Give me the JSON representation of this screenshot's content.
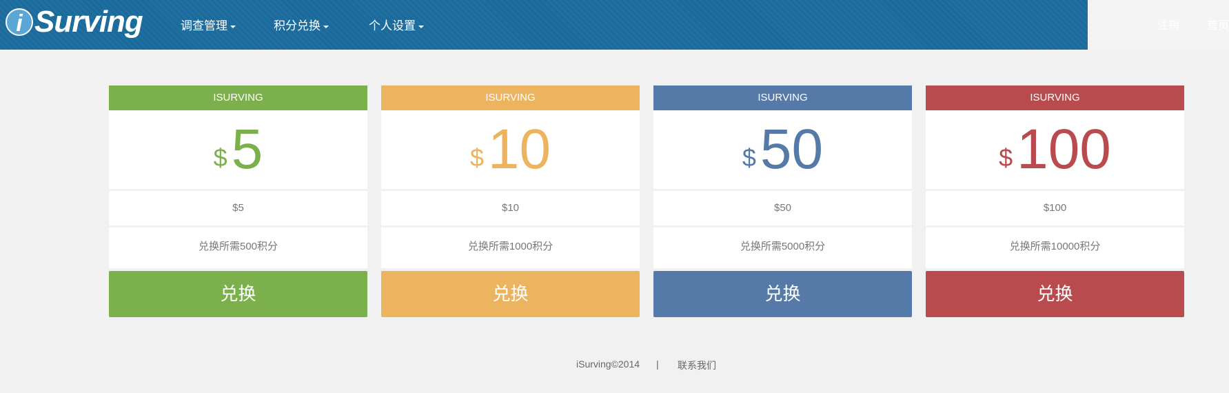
{
  "navbar": {
    "logo_text": "Surving",
    "logo_letter": "i",
    "menus": [
      {
        "label": "调查管理"
      },
      {
        "label": "积分兑换"
      },
      {
        "label": "个人设置"
      }
    ],
    "right_links": [
      "注销",
      "首页"
    ]
  },
  "cards": [
    {
      "header": "ISURVING",
      "currency": "$",
      "value": "5",
      "amount": "$5",
      "points": "兑换所需500积分",
      "button": "兑换",
      "color": "#7cb04c"
    },
    {
      "header": "ISURVING",
      "currency": "$",
      "value": "10",
      "amount": "$10",
      "points": "兑换所需1000积分",
      "button": "兑换",
      "color": "#ecb45f"
    },
    {
      "header": "ISURVING",
      "currency": "$",
      "value": "50",
      "amount": "$50",
      "points": "兑换所需5000积分",
      "button": "兑换",
      "color": "#567aa8"
    },
    {
      "header": "ISURVING",
      "currency": "$",
      "value": "100",
      "amount": "$100",
      "points": "兑换所需10000积分",
      "button": "兑换",
      "color": "#b94b4f"
    }
  ],
  "footer": {
    "copyright": "iSurving©2014",
    "separator": "|",
    "contact": "联系我们"
  }
}
